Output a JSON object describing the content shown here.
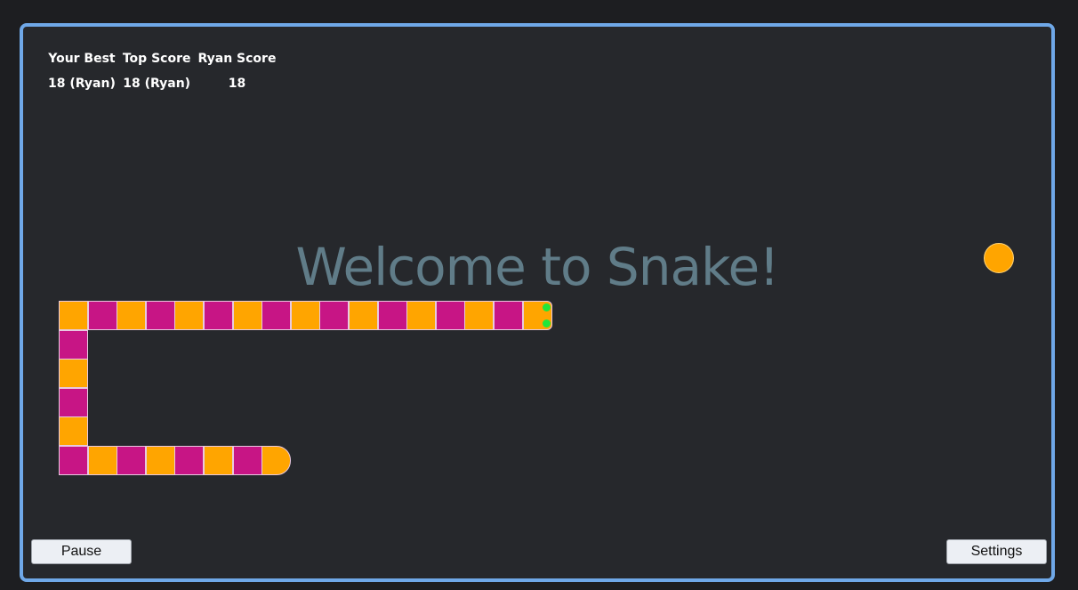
{
  "scoreboard": {
    "headers": [
      "Your Best",
      "Top Score",
      "Ryan Score"
    ],
    "values": [
      "18 (Ryan)",
      "18 (Ryan)",
      "18"
    ]
  },
  "welcome_text": "Welcome to Snake!",
  "colors": {
    "border": "#6fa8e8",
    "board_bg": "#26282c",
    "snake_a": "#ffa500",
    "snake_b": "#c71585",
    "eyes": "#22e63a",
    "food": "#ffa500"
  },
  "controls": {
    "pause_label": "Pause",
    "settings_label": "Settings"
  }
}
